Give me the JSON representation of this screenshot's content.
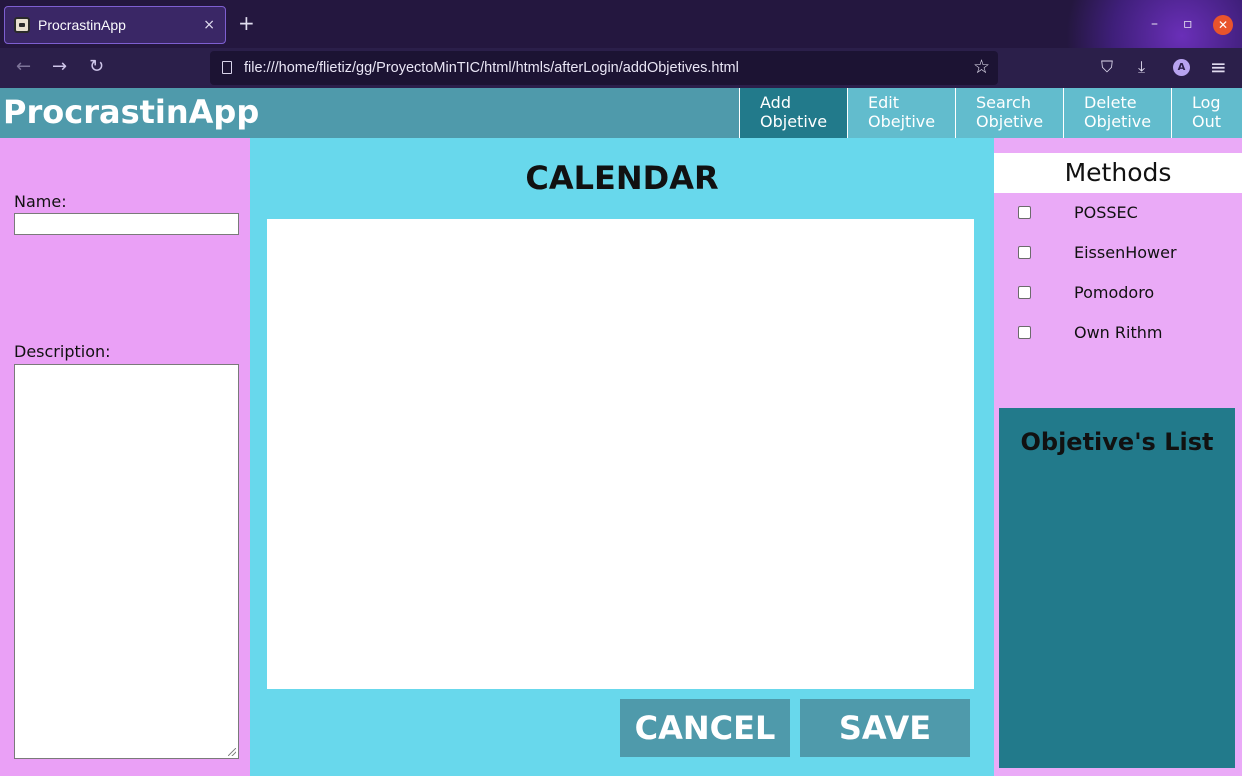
{
  "browser": {
    "tab_title": "ProcrastinApp",
    "tab_close": "×",
    "new_tab": "+",
    "url": "file:///home/flietiz/gg/ProyectoMinTIC/html/htmls/afterLogin/addObjetives.html",
    "back": "←",
    "forward": "→",
    "reload": "↻",
    "bookmark": "☆",
    "pocket": "⛉",
    "download": "⤓",
    "account": "A",
    "menu": "≡",
    "minimize": "–",
    "maximize": "▫",
    "close": "✕"
  },
  "app": {
    "brand": "ProcrastinApp",
    "nav": [
      {
        "line1": "Add",
        "line2": "Objetive"
      },
      {
        "line1": "Edit",
        "line2": "Obejtive"
      },
      {
        "line1": "Search",
        "line2": "Objetive"
      },
      {
        "line1": "Delete",
        "line2": "Objetive"
      },
      {
        "line1": "Log",
        "line2": "Out"
      }
    ]
  },
  "form": {
    "name_label": "Name:",
    "name_value": "",
    "description_label": "Description:",
    "description_value": ""
  },
  "calendar": {
    "title": "CALENDAR"
  },
  "actions": {
    "cancel": "CANCEL",
    "save": "SAVE"
  },
  "methods": {
    "title": "Methods",
    "items": [
      "POSSEC",
      "EissenHower",
      "Pomodoro",
      "Own Rithm"
    ]
  },
  "objectives": {
    "title": "Objetive's List"
  },
  "colors": {
    "header": "#4f9aab",
    "active_nav": "#227a8b",
    "nav": "#62bccd",
    "side_panel": "#eaa0f6",
    "center_panel": "#68d8ec",
    "list_panel": "#227a8b"
  }
}
